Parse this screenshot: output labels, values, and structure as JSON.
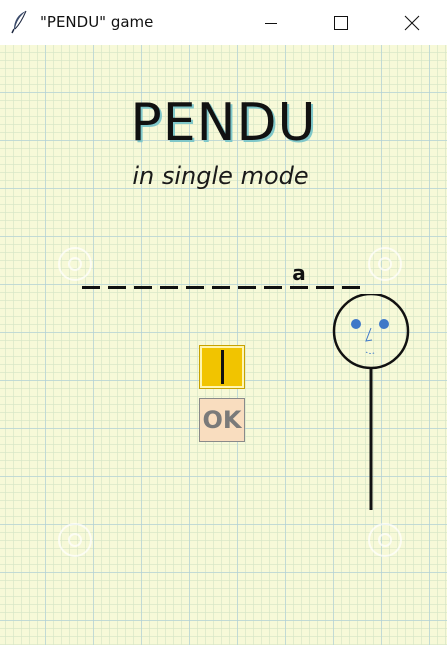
{
  "window": {
    "title": "\"PENDU\" game",
    "icon": "feather-icon",
    "controls": {
      "minimize": "minimize-icon",
      "maximize": "maximize-icon",
      "close": "close-icon"
    }
  },
  "game": {
    "title": "PENDU",
    "subtitle": "in single mode",
    "word_slots": [
      "",
      "",
      "",
      "",
      "",
      "",
      "",
      "",
      "a",
      "",
      ""
    ],
    "letter_input_value": "",
    "ok_label": "OK",
    "hangman_parts": [
      "pole",
      "head",
      "eyes",
      "nose",
      "mouth"
    ]
  },
  "colors": {
    "canvas_background": "#f7f9d8",
    "input_background": "#f1c400",
    "ok_background": "#f9ddbf",
    "eye_color": "#3f78c8",
    "title_shadow": "#7fc7c9"
  }
}
